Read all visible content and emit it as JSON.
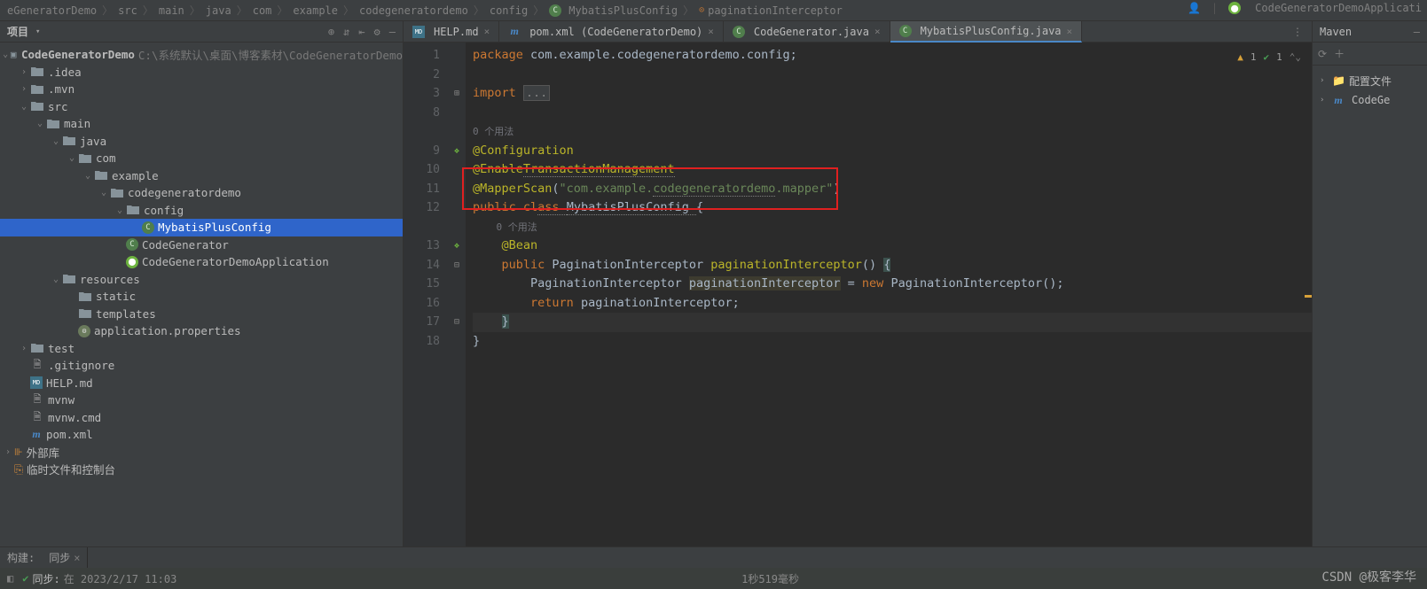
{
  "breadcrumb": {
    "items": [
      "eGeneratorDemo",
      "src",
      "main",
      "java",
      "com",
      "example",
      "codegeneratordemo",
      "config",
      "MybatisPlusConfig",
      "paginationInterceptor"
    ]
  },
  "run_config": "CodeGeneratorDemoApplicati",
  "project": {
    "header": "项目",
    "root": "CodeGeneratorDemo",
    "root_path": "C:\\系统默认\\桌面\\博客素材\\CodeGeneratorDemo",
    "tree": [
      {
        "indent": 1,
        "arrow": ">",
        "icon": "folder",
        "label": ".idea"
      },
      {
        "indent": 1,
        "arrow": ">",
        "icon": "folder",
        "label": ".mvn"
      },
      {
        "indent": 1,
        "arrow": "v",
        "icon": "folder",
        "label": "src",
        "bold": false
      },
      {
        "indent": 2,
        "arrow": "v",
        "icon": "folder",
        "label": "main"
      },
      {
        "indent": 3,
        "arrow": "v",
        "icon": "folder",
        "label": "java"
      },
      {
        "indent": 4,
        "arrow": "v",
        "icon": "folder",
        "label": "com"
      },
      {
        "indent": 5,
        "arrow": "v",
        "icon": "folder",
        "label": "example"
      },
      {
        "indent": 6,
        "arrow": "v",
        "icon": "folder",
        "label": "codegeneratordemo"
      },
      {
        "indent": 7,
        "arrow": "v",
        "icon": "folder",
        "label": "config"
      },
      {
        "indent": 8,
        "arrow": "",
        "icon": "java",
        "label": "MybatisPlusConfig",
        "selected": true
      },
      {
        "indent": 7,
        "arrow": "",
        "icon": "java",
        "label": "CodeGenerator"
      },
      {
        "indent": 7,
        "arrow": "",
        "icon": "sb",
        "label": "CodeGeneratorDemoApplication"
      },
      {
        "indent": 3,
        "arrow": "v",
        "icon": "folder",
        "label": "resources"
      },
      {
        "indent": 4,
        "arrow": "",
        "icon": "folder",
        "label": "static"
      },
      {
        "indent": 4,
        "arrow": "",
        "icon": "folder",
        "label": "templates"
      },
      {
        "indent": 4,
        "arrow": "",
        "icon": "cfg",
        "label": "application.properties"
      },
      {
        "indent": 1,
        "arrow": ">",
        "icon": "folder",
        "label": "test"
      },
      {
        "indent": 1,
        "arrow": "",
        "icon": "file",
        "label": ".gitignore"
      },
      {
        "indent": 1,
        "arrow": "",
        "icon": "md",
        "label": "HELP.md"
      },
      {
        "indent": 1,
        "arrow": "",
        "icon": "file",
        "label": "mvnw"
      },
      {
        "indent": 1,
        "arrow": "",
        "icon": "file",
        "label": "mvnw.cmd"
      },
      {
        "indent": 1,
        "arrow": "",
        "icon": "m",
        "label": "pom.xml"
      }
    ],
    "external": "外部库",
    "scratch": "临时文件和控制台"
  },
  "tabs": [
    {
      "icon": "md",
      "label": "HELP.md",
      "active": false
    },
    {
      "icon": "m",
      "label": "pom.xml (CodeGeneratorDemo)",
      "active": false
    },
    {
      "icon": "java",
      "label": "CodeGenerator.java",
      "active": false
    },
    {
      "icon": "java",
      "label": "MybatisPlusConfig.java",
      "active": true
    }
  ],
  "editor": {
    "lines": [
      {
        "n": 1,
        "gi": "",
        "segs": [
          {
            "t": "package ",
            "c": "kw"
          },
          {
            "t": "com.example.codegeneratordemo.config;",
            "c": "cls"
          }
        ]
      },
      {
        "n": 2,
        "gi": ""
      },
      {
        "n": 3,
        "gi": "",
        "collapse": "+",
        "segs": [
          {
            "t": "import ",
            "c": "kw"
          },
          {
            "t": "...",
            "c": "com",
            "bg": true
          }
        ]
      },
      {
        "n": 8,
        "gi": ""
      },
      {
        "hint": "0 个用法"
      },
      {
        "n": 9,
        "gi": "leaf",
        "collapse": "-",
        "segs": [
          {
            "t": "@Configuration",
            "c": "ann"
          }
        ]
      },
      {
        "n": 10,
        "gi": "",
        "segs": [
          {
            "t": "@Enable",
            "c": "ann"
          },
          {
            "t": "TransactionManagement",
            "c": "ann",
            "und": true
          }
        ]
      },
      {
        "n": 11,
        "gi": "",
        "segs": [
          {
            "t": "@MapperScan",
            "c": "ann"
          },
          {
            "t": "(",
            "c": "cls"
          },
          {
            "t": "\"com.example.",
            "c": "str"
          },
          {
            "t": "codegeneratordemo",
            "c": "str",
            "und": true
          },
          {
            "t": ".mapper\"",
            "c": "str"
          },
          {
            "t": ")",
            "c": "cls"
          }
        ]
      },
      {
        "n": 12,
        "gi": "",
        "segs": [
          {
            "t": "public ",
            "c": "kw"
          },
          {
            "t": "cl",
            "c": "kw"
          },
          {
            "t": "ass ",
            "c": "kw",
            "und": true
          },
          {
            "t": "MybatisPlusConfig ",
            "c": "cls",
            "und": true
          },
          {
            "t": "{",
            "c": "cls"
          }
        ]
      },
      {
        "hint": "0 个用法",
        "indent": "    "
      },
      {
        "n": 13,
        "gi": "leaf",
        "segs": [
          {
            "t": "    ",
            "c": ""
          },
          {
            "t": "@Bean",
            "c": "ann"
          }
        ]
      },
      {
        "n": 14,
        "gi": "",
        "collapse": "-",
        "segs": [
          {
            "t": "    ",
            "c": ""
          },
          {
            "t": "public ",
            "c": "kw"
          },
          {
            "t": "PaginationInterceptor ",
            "c": "cls"
          },
          {
            "t": "paginationInterceptor",
            "c": "ann"
          },
          {
            "t": "() ",
            "c": "cls"
          },
          {
            "t": "{",
            "c": "cls",
            "hlbg": true
          }
        ]
      },
      {
        "n": 15,
        "gi": "",
        "segs": [
          {
            "t": "        PaginationInterceptor ",
            "c": "cls"
          },
          {
            "t": "paginationInterceptor",
            "c": "cls",
            "hl": true
          },
          {
            "t": " = ",
            "c": "cls"
          },
          {
            "t": "new ",
            "c": "kw"
          },
          {
            "t": "PaginationInterceptor();",
            "c": "cls"
          }
        ]
      },
      {
        "n": 16,
        "gi": "",
        "segs": [
          {
            "t": "        ",
            "c": ""
          },
          {
            "t": "return ",
            "c": "kw"
          },
          {
            "t": "paginationInterceptor;",
            "c": "cls"
          }
        ]
      },
      {
        "n": 17,
        "gi": "",
        "caret": true,
        "collapse": "-",
        "segs": [
          {
            "t": "    ",
            "c": ""
          },
          {
            "t": "}",
            "c": "cls",
            "hlbg": true
          }
        ]
      },
      {
        "n": 18,
        "gi": "",
        "segs": [
          {
            "t": "}",
            "c": "cls"
          }
        ]
      }
    ],
    "status": {
      "warn": "1",
      "ok": "1"
    }
  },
  "right_panel": {
    "title": "Maven",
    "items": [
      {
        "icon": "folder",
        "label": "配置文件"
      },
      {
        "icon": "m",
        "label": "CodeGe"
      }
    ]
  },
  "tool_window": {
    "left_label": "构建:",
    "tab1": "同步"
  },
  "status": {
    "ok_label": "同步:",
    "msg": "在 2023/2/17 11:03",
    "duration": "1秒519毫秒"
  },
  "watermark": "CSDN @极客李华"
}
